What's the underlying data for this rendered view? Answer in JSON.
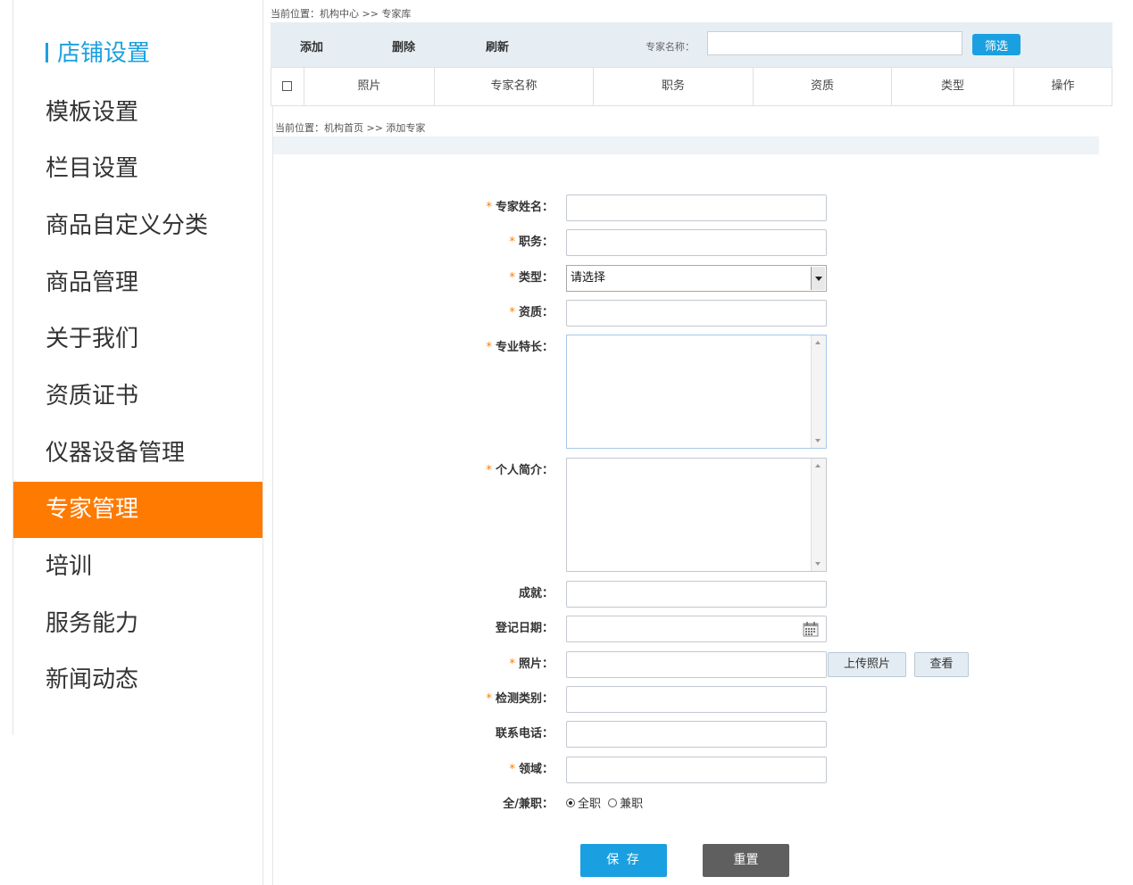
{
  "sidebar": {
    "title": "店铺设置",
    "items": [
      {
        "label": "模板设置"
      },
      {
        "label": "栏目设置"
      },
      {
        "label": "商品自定义分类"
      },
      {
        "label": "商品管理"
      },
      {
        "label": "关于我们"
      },
      {
        "label": "资质证书"
      },
      {
        "label": "仪器设备管理"
      },
      {
        "label": "专家管理",
        "active": true
      },
      {
        "label": "培训"
      },
      {
        "label": "服务能力"
      },
      {
        "label": "新闻动态"
      }
    ]
  },
  "list_panel": {
    "breadcrumb": "当前位置：机构中心 >> 专家库",
    "toolbar": {
      "add": "添加",
      "delete": "删除",
      "refresh": "刷新"
    },
    "filter": {
      "label": "专家名称：",
      "value": "",
      "button": "筛选"
    },
    "columns": [
      "照片",
      "专家名称",
      "职务",
      "资质",
      "类型",
      "操作"
    ]
  },
  "form_panel": {
    "breadcrumb": "当前位置：机构首页 >> 添加专家",
    "fields": {
      "name": {
        "label": "专家姓名："
      },
      "position": {
        "label": "职务："
      },
      "type": {
        "label": "类型：",
        "selected": "请选择"
      },
      "qualification": {
        "label": "资质："
      },
      "specialty": {
        "label": "专业特长："
      },
      "intro": {
        "label": "个人简介："
      },
      "achievement": {
        "label": "成就："
      },
      "reg_date": {
        "label": "登记日期："
      },
      "photo": {
        "label": "照片：",
        "upload_button": "上传照片",
        "view_button": "查看"
      },
      "test_category": {
        "label": "检测类别："
      },
      "phone": {
        "label": "联系电话："
      },
      "domain": {
        "label": "领域："
      },
      "employment": {
        "label": "全/兼职：",
        "options": [
          "全职",
          "兼职"
        ],
        "selected": "全职"
      }
    },
    "required_mark": "*",
    "save_button": "保 存",
    "reset_button": "重置"
  },
  "colors": {
    "accent": "#1aa0e0",
    "active_nav": "#ff7a00",
    "reset": "#5f5f5f"
  }
}
